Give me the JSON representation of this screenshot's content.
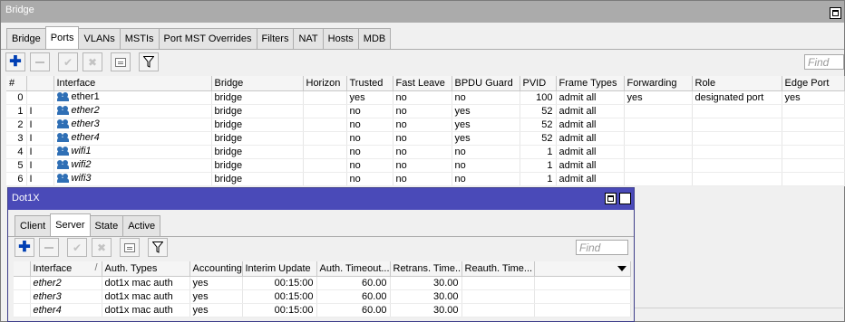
{
  "bridge_window": {
    "title": "Bridge",
    "tabs": [
      {
        "label": "Bridge",
        "active": false
      },
      {
        "label": "Ports",
        "active": true
      },
      {
        "label": "VLANs",
        "active": false
      },
      {
        "label": "MSTIs",
        "active": false
      },
      {
        "label": "Port MST Overrides",
        "active": false
      },
      {
        "label": "Filters",
        "active": false
      },
      {
        "label": "NAT",
        "active": false
      },
      {
        "label": "Hosts",
        "active": false
      },
      {
        "label": "MDB",
        "active": false
      }
    ],
    "find_placeholder": "Find",
    "columns": [
      "#",
      "",
      "Interface",
      "Bridge",
      "Horizon",
      "Trusted",
      "Fast Leave",
      "BPDU Guard",
      "PVID",
      "Frame Types",
      "Forwarding",
      "Role",
      "Edge Port"
    ],
    "rows": [
      {
        "num": "0",
        "flag": "",
        "iface": "ether1",
        "italic": false,
        "bridge": "bridge",
        "horizon": "",
        "trusted": "yes",
        "fast_leave": "no",
        "bpdu": "no",
        "pvid": "100",
        "frame": "admit all",
        "fwd": "yes",
        "role": "designated port",
        "edge": "yes"
      },
      {
        "num": "1",
        "flag": "I",
        "iface": "ether2",
        "italic": true,
        "bridge": "bridge",
        "horizon": "",
        "trusted": "no",
        "fast_leave": "no",
        "bpdu": "yes",
        "pvid": "52",
        "frame": "admit all",
        "fwd": "",
        "role": "",
        "edge": ""
      },
      {
        "num": "2",
        "flag": "I",
        "iface": "ether3",
        "italic": true,
        "bridge": "bridge",
        "horizon": "",
        "trusted": "no",
        "fast_leave": "no",
        "bpdu": "yes",
        "pvid": "52",
        "frame": "admit all",
        "fwd": "",
        "role": "",
        "edge": ""
      },
      {
        "num": "3",
        "flag": "I",
        "iface": "ether4",
        "italic": true,
        "bridge": "bridge",
        "horizon": "",
        "trusted": "no",
        "fast_leave": "no",
        "bpdu": "yes",
        "pvid": "52",
        "frame": "admit all",
        "fwd": "",
        "role": "",
        "edge": ""
      },
      {
        "num": "4",
        "flag": "I",
        "iface": "wifi1",
        "italic": true,
        "bridge": "bridge",
        "horizon": "",
        "trusted": "no",
        "fast_leave": "no",
        "bpdu": "no",
        "pvid": "1",
        "frame": "admit all",
        "fwd": "",
        "role": "",
        "edge": ""
      },
      {
        "num": "5",
        "flag": "I",
        "iface": "wifi2",
        "italic": true,
        "bridge": "bridge",
        "horizon": "",
        "trusted": "no",
        "fast_leave": "no",
        "bpdu": "no",
        "pvid": "1",
        "frame": "admit all",
        "fwd": "",
        "role": "",
        "edge": ""
      },
      {
        "num": "6",
        "flag": "I",
        "iface": "wifi3",
        "italic": true,
        "bridge": "bridge",
        "horizon": "",
        "trusted": "no",
        "fast_leave": "no",
        "bpdu": "no",
        "pvid": "1",
        "frame": "admit all",
        "fwd": "",
        "role": "",
        "edge": ""
      }
    ]
  },
  "dot1x_window": {
    "title": "Dot1X",
    "tabs": [
      {
        "label": "Client",
        "active": false
      },
      {
        "label": "Server",
        "active": true
      },
      {
        "label": "State",
        "active": false
      },
      {
        "label": "Active",
        "active": false
      }
    ],
    "find_placeholder": "Find",
    "columns": [
      "",
      "Interface",
      "Auth. Types",
      "Accounting",
      "Interim Update",
      "Auth. Timeout...",
      "Retrans. Time...",
      "Reauth. Time..."
    ],
    "rows": [
      {
        "iface": "ether2",
        "auth_types": "dot1x mac auth",
        "accounting": "yes",
        "interim": "00:15:00",
        "auth_timeout": "60.00",
        "retrans": "30.00",
        "reauth": ""
      },
      {
        "iface": "ether3",
        "auth_types": "dot1x mac auth",
        "accounting": "yes",
        "interim": "00:15:00",
        "auth_timeout": "60.00",
        "retrans": "30.00",
        "reauth": ""
      },
      {
        "iface": "ether4",
        "auth_types": "dot1x mac auth",
        "accounting": "yes",
        "interim": "00:15:00",
        "auth_timeout": "60.00",
        "retrans": "30.00",
        "reauth": ""
      }
    ]
  },
  "colors": {
    "bridge_titlebar": "#ababab",
    "dot1x_titlebar": "#4a4ab8",
    "add_icon": "#003fb4",
    "interface_icon": "#2f6fb5"
  },
  "icons": [
    "add-icon",
    "remove-icon",
    "enable-icon",
    "disable-icon",
    "comment-icon",
    "filter-icon",
    "interface-icon",
    "maximize-icon",
    "close-icon",
    "dropdown-arrow-icon"
  ]
}
